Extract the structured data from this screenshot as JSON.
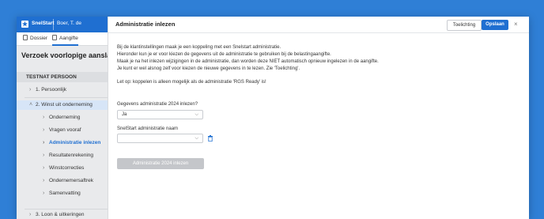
{
  "brand": {
    "logo_icon": "snelstart-star-icon",
    "app_name": "SnelStart",
    "user": "Boer, T. de"
  },
  "tabs": [
    {
      "label": "Dossier",
      "icon": "document-icon"
    },
    {
      "label": "Aangifte",
      "icon": "form-icon",
      "active": true
    }
  ],
  "left": {
    "title": "Verzoek voorlopige aanslag I",
    "section": "TESTNAT PERSOON",
    "items": [
      {
        "label": "1. Persoonlijk"
      },
      {
        "label": "2. Winst uit onderneming"
      },
      {
        "label": "Onderneming"
      },
      {
        "label": "Vragen vooraf"
      },
      {
        "label": "Administratie inlezen",
        "active": true
      },
      {
        "label": "Resultatenrekening"
      },
      {
        "label": "Winstcorrecties"
      },
      {
        "label": "Ondernemersaftrek"
      },
      {
        "label": "Samenvatting"
      },
      {
        "label": "3. Loon & uitkeringen"
      }
    ]
  },
  "modal": {
    "title": "Administratie inlezen",
    "help_label": "Toelichting",
    "save_label": "Opslaan",
    "close_label": "×",
    "paragraphs": [
      "Bij de klantinstellingen maak je een koppeling met een Snelstart administratie.",
      "Hieronder kun je er voor kiezen de gegevens uit de administratie te gebruiken bij de belastingaangifte.",
      "Maak je na het inlezen wijzigingen in de administratie, dan worden deze NIET automatisch opnieuw ingelezen in de aangifte.",
      "Je kunt er wel alsnog zelf voor kiezen de nieuwe gegevens in te lezen. Zie 'Toelichting'."
    ],
    "note": "Let op: koppelen is alleen mogelijk als de administratie 'RGS Ready' is!",
    "question_label": "Gegevens administratie 2024 inlezen?",
    "question_value": "Ja",
    "admin_label": "SnelStart administratie naam",
    "admin_value": "",
    "submit_label": "Administratie 2024 inlezen"
  },
  "colors": {
    "accent": "#1f6fd1",
    "background": "#2f7fd6",
    "disabled": "#c4c6ca"
  }
}
